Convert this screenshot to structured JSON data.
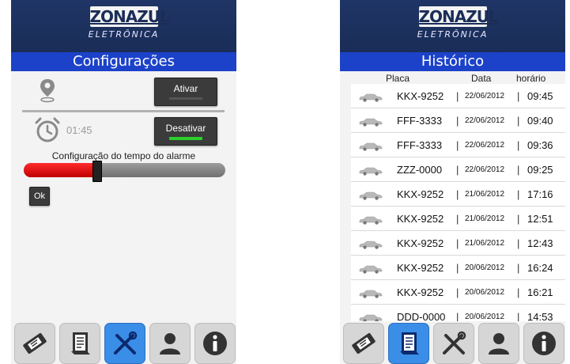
{
  "brand": {
    "logo_main": "ZONAZUL",
    "logo_sub": "ELETRÔNICA"
  },
  "settings_screen": {
    "title": "Configurações",
    "location": {
      "icon": "map-pin-icon",
      "button_label": "Ativar",
      "active": false
    },
    "alarm": {
      "icon": "alarm-clock-icon",
      "time": "01:45",
      "button_label": "Desativar",
      "active": true
    },
    "slider": {
      "label": "Configuração do tempo do alarme",
      "value_fraction": 0.36
    },
    "ok_label": "Ok"
  },
  "history_screen": {
    "title": "Histórico",
    "columns": [
      "Placa",
      "Data",
      "horário"
    ],
    "rows": [
      {
        "placa": "KKX-9252",
        "data": "22/06/2012",
        "horario": "09:45"
      },
      {
        "placa": "FFF-3333",
        "data": "22/06/2012",
        "horario": "09:40"
      },
      {
        "placa": "FFF-3333",
        "data": "22/06/2012",
        "horario": "09:36"
      },
      {
        "placa": "ZZZ-0000",
        "data": "22/06/2012",
        "horario": "09:25"
      },
      {
        "placa": "KKX-9252",
        "data": "21/06/2012",
        "horario": "17:16"
      },
      {
        "placa": "KKX-9252",
        "data": "21/06/2012",
        "horario": "12:51"
      },
      {
        "placa": "KKX-9252",
        "data": "21/06/2012",
        "horario": "12:43"
      },
      {
        "placa": "KKX-9252",
        "data": "20/06/2012",
        "horario": "16:24"
      },
      {
        "placa": "KKX-9252",
        "data": "20/06/2012",
        "horario": "16:21"
      },
      {
        "placa": "DDD-0000",
        "data": "20/06/2012",
        "horario": "14:53"
      }
    ]
  },
  "nav": {
    "items": [
      "ticket-icon",
      "receipt-list-icon",
      "tools-icon",
      "user-icon",
      "info-icon"
    ],
    "settings_active_index": 2,
    "history_active_index": 1
  },
  "colors": {
    "header": "#1f3565",
    "title_bar": "#1c42c9",
    "active_nav": "#3a8ee8",
    "alarm_on": "#2ccf2c",
    "slider_fill": "#e01010"
  }
}
